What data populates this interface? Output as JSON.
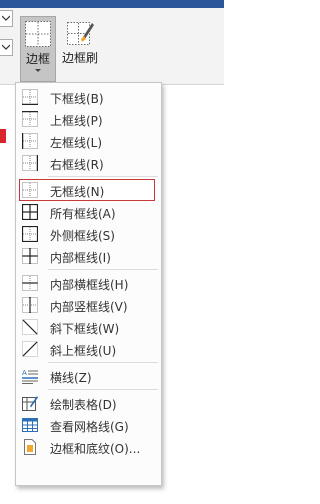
{
  "ribbon": {
    "borders_label": "边框",
    "border_painter_label": "边框刷"
  },
  "menu": {
    "items": [
      {
        "label": "下框线(B)",
        "icon": "bottom-border-icon"
      },
      {
        "label": "上框线(P)",
        "icon": "top-border-icon"
      },
      {
        "label": "左框线(L)",
        "icon": "left-border-icon"
      },
      {
        "label": "右框线(R)",
        "icon": "right-border-icon"
      },
      {
        "label": "无框线(N)",
        "icon": "no-border-icon",
        "selected": true
      },
      {
        "label": "所有框线(A)",
        "icon": "all-borders-icon"
      },
      {
        "label": "外侧框线(S)",
        "icon": "outside-borders-icon"
      },
      {
        "label": "内部框线(I)",
        "icon": "inside-borders-icon"
      },
      {
        "label": "内部横框线(H)",
        "icon": "inside-horizontal-border-icon"
      },
      {
        "label": "内部竖框线(V)",
        "icon": "inside-vertical-border-icon"
      },
      {
        "label": "斜下框线(W)",
        "icon": "diagonal-down-border-icon"
      },
      {
        "label": "斜上框线(U)",
        "icon": "diagonal-up-border-icon"
      },
      {
        "label": "横线(Z)",
        "icon": "horizontal-line-icon"
      },
      {
        "label": "绘制表格(D)",
        "icon": "draw-table-icon"
      },
      {
        "label": "查看网格线(G)",
        "icon": "view-gridlines-icon"
      },
      {
        "label": "边框和底纹(O)...",
        "icon": "borders-and-shading-icon"
      }
    ]
  },
  "colors": {
    "title_bar": "#2b579a",
    "selected_outline": "#c8393c",
    "icon_blue": "#2f6fb7"
  }
}
